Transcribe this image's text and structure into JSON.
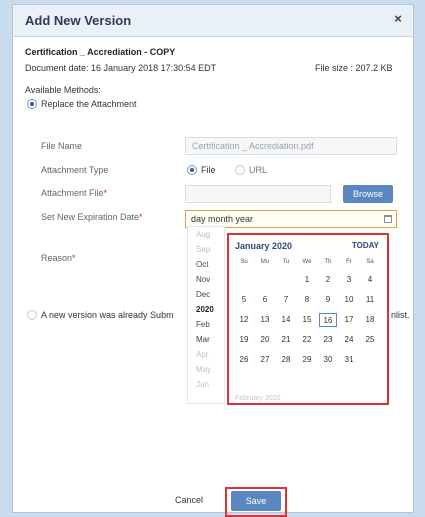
{
  "dialog": {
    "title": "Add New Version",
    "close_icon": "close-icon"
  },
  "document": {
    "name": "Certification _ Accrediation - COPY",
    "date_label": "Document date: 16 January 2018 17:30:54 EDT",
    "file_size": "File size : 207.2 KB"
  },
  "methods": {
    "label": "Available Methods:",
    "option1": "Replace the Attachment",
    "option2": "A new version was already Subm",
    "option2_tail": "nlist."
  },
  "form": {
    "file_name_label": "File Name",
    "file_name_value": "Certification _ Accrediation.pdf",
    "attachment_type_label": "Attachment Type",
    "type_file": "File",
    "type_url": "URL",
    "attachment_file_label": "Attachment File",
    "browse_label": "Browse",
    "expiration_label": "Set New Expiration Date",
    "date_placeholder": "day month year",
    "reason_label": "Reason",
    "required_mark": "*"
  },
  "month_list": [
    "Aug",
    "Sep",
    "Oct",
    "Nov",
    "Dec",
    "2020",
    "Feb",
    "Mar",
    "Apr",
    "May",
    "Jun"
  ],
  "calendar": {
    "month": "January 2020",
    "today": "TODAY",
    "weekdays": [
      "Su",
      "Mo",
      "Tu",
      "We",
      "Th",
      "Fr",
      "Sa"
    ],
    "days": [
      [
        "",
        "",
        "",
        "1",
        "2",
        "3",
        "4"
      ],
      [
        "5",
        "6",
        "7",
        "8",
        "9",
        "10",
        "11"
      ],
      [
        "12",
        "13",
        "14",
        "15",
        "16",
        "17",
        "18"
      ],
      [
        "19",
        "20",
        "21",
        "22",
        "23",
        "24",
        "25"
      ],
      [
        "26",
        "27",
        "28",
        "29",
        "30",
        "31",
        ""
      ]
    ],
    "today_day": "16",
    "next_month": "February 2020"
  },
  "footer": {
    "cancel": "Cancel",
    "save": "Save"
  }
}
